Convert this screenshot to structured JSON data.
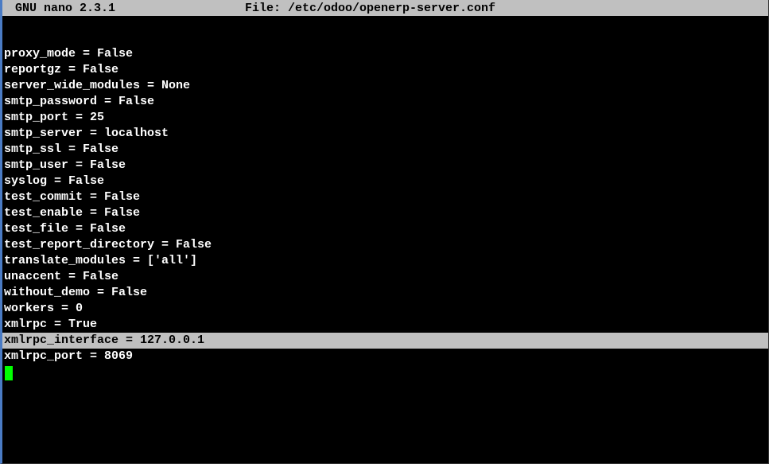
{
  "titlebar": {
    "app": "GNU nano 2.3.1",
    "file_label": "File: /etc/odoo/openerp-server.conf"
  },
  "lines": [
    {
      "text": "proxy_mode = False",
      "highlight": false
    },
    {
      "text": "reportgz = False",
      "highlight": false
    },
    {
      "text": "server_wide_modules = None",
      "highlight": false
    },
    {
      "text": "smtp_password = False",
      "highlight": false
    },
    {
      "text": "smtp_port = 25",
      "highlight": false
    },
    {
      "text": "smtp_server = localhost",
      "highlight": false
    },
    {
      "text": "smtp_ssl = False",
      "highlight": false
    },
    {
      "text": "smtp_user = False",
      "highlight": false
    },
    {
      "text": "syslog = False",
      "highlight": false
    },
    {
      "text": "test_commit = False",
      "highlight": false
    },
    {
      "text": "test_enable = False",
      "highlight": false
    },
    {
      "text": "test_file = False",
      "highlight": false
    },
    {
      "text": "test_report_directory = False",
      "highlight": false
    },
    {
      "text": "translate_modules = ['all']",
      "highlight": false
    },
    {
      "text": "unaccent = False",
      "highlight": false
    },
    {
      "text": "without_demo = False",
      "highlight": false
    },
    {
      "text": "workers = 0",
      "highlight": false
    },
    {
      "text": "xmlrpc = True",
      "highlight": false
    },
    {
      "text": "xmlrpc_interface = 127.0.0.1",
      "highlight": true
    },
    {
      "text": "xmlrpc_port = 8069",
      "highlight": false
    }
  ]
}
